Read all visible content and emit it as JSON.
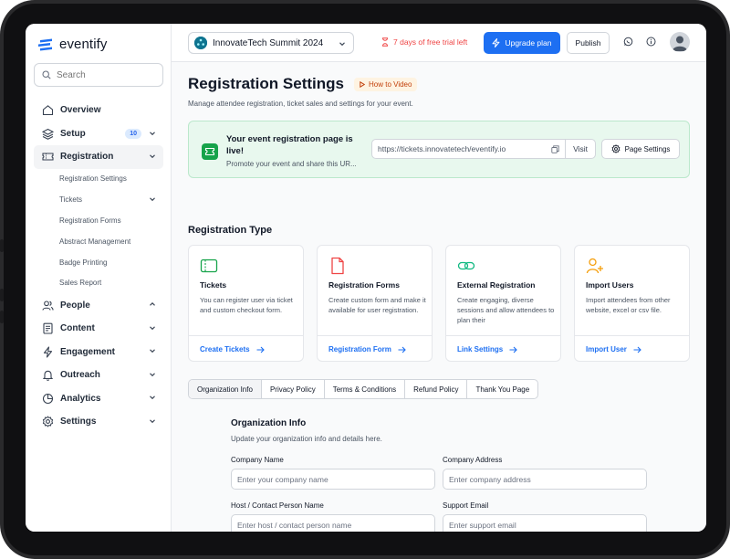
{
  "app": {
    "logo_text": "eventify",
    "brand_color": "#1d6ff2"
  },
  "sidebar": {
    "search_placeholder": "Search",
    "items": [
      {
        "label": "Overview",
        "icon": "home-icon"
      },
      {
        "label": "Setup",
        "icon": "layers-icon",
        "badge": "10"
      },
      {
        "label": "Registration",
        "icon": "ticket-icon"
      },
      {
        "label": "People",
        "icon": "users-icon"
      },
      {
        "label": "Content",
        "icon": "document-icon"
      },
      {
        "label": "Engagement",
        "icon": "bolt-icon"
      },
      {
        "label": "Outreach",
        "icon": "bell-icon"
      },
      {
        "label": "Analytics",
        "icon": "pie-chart-icon"
      },
      {
        "label": "Settings",
        "icon": "gear-icon"
      }
    ],
    "registration_sub": [
      "Registration Settings",
      "Tickets",
      "Registration Forms",
      "Abstract Management",
      "Badge Printing",
      "Sales Report"
    ]
  },
  "topbar": {
    "event_name": "InnovateTech Summit 2024",
    "trial_text": "7 days of free trial left",
    "upgrade_label": "Upgrade plan",
    "publish_label": "Publish"
  },
  "page": {
    "title": "Registration Settings",
    "howto_label": "How to Video",
    "subtitle": "Manage attendee registration, ticket sales and settings for your event."
  },
  "live_banner": {
    "title": "Your event registration page is live!",
    "description": "Promote your event and share this UR...",
    "url": "https://tickets.innovatetech/eventify.io",
    "visit_label": "Visit",
    "page_settings_label": "Page Settings"
  },
  "registration_type": {
    "title": "Registration Type",
    "cards": [
      {
        "title": "Tickets",
        "description": "You can register user via ticket and custom checkout form.",
        "link": "Create Tickets",
        "icon": "ticket-icon"
      },
      {
        "title": "Registration Forms",
        "description": "Create custom form and make it available for user registration.",
        "link": "Registration Form",
        "icon": "file-icon"
      },
      {
        "title": "External Registration",
        "description": "Create engaging, diverse sessions and allow attendees to plan their",
        "link": "Link Settings",
        "icon": "link-icon"
      },
      {
        "title": "Import Users",
        "description": "Import attendees from other website, excel or csv file.",
        "link": "Import User",
        "icon": "user-plus-icon"
      }
    ]
  },
  "tabs": [
    "Organization Info",
    "Privacy Policy",
    "Terms & Conditions",
    "Refund Policy",
    "Thank You Page"
  ],
  "org_info": {
    "title": "Organization Info",
    "subtitle": "Update your organization info and details here.",
    "fields": [
      {
        "label": "Company Name",
        "placeholder": "Enter your company name"
      },
      {
        "label": "Company Address",
        "placeholder": "Enter company address"
      },
      {
        "label": "Host / Contact Person Name",
        "placeholder": "Enter host / contact person name"
      },
      {
        "label": "Support Email",
        "placeholder": "Enter support email"
      }
    ]
  }
}
